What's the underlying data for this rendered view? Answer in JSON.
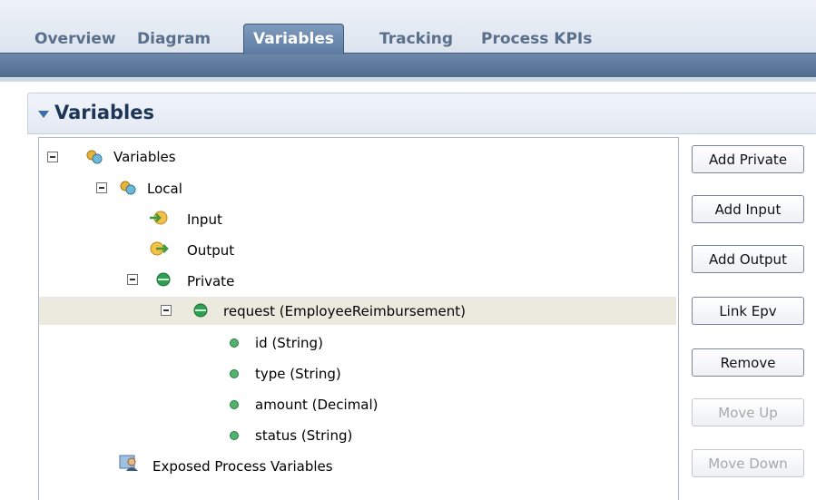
{
  "tabs": [
    {
      "label": "Overview",
      "active": false
    },
    {
      "label": "Diagram",
      "active": false
    },
    {
      "label": "Variables",
      "active": true
    },
    {
      "label": "Tracking",
      "active": false
    },
    {
      "label": "Process KPIs",
      "active": false
    }
  ],
  "section": {
    "title": "Variables"
  },
  "tree": {
    "root": "Variables",
    "local": "Local",
    "input": "Input",
    "output": "Output",
    "private": "Private",
    "request": "request (EmployeeReimbursement)",
    "fields": [
      "id (String)",
      "type (String)",
      "amount (Decimal)",
      "status (String)"
    ],
    "exposed": "Exposed Process Variables"
  },
  "buttons": {
    "add_private": "Add Private",
    "add_input": "Add Input",
    "add_output": "Add Output",
    "link_epv": "Link Epv",
    "remove": "Remove",
    "move_up": "Move Up",
    "move_down": "Move Down"
  },
  "colors": {
    "accent": "#5e7ca3",
    "selection": "#eceadf",
    "private_icon": "#2fa052"
  }
}
